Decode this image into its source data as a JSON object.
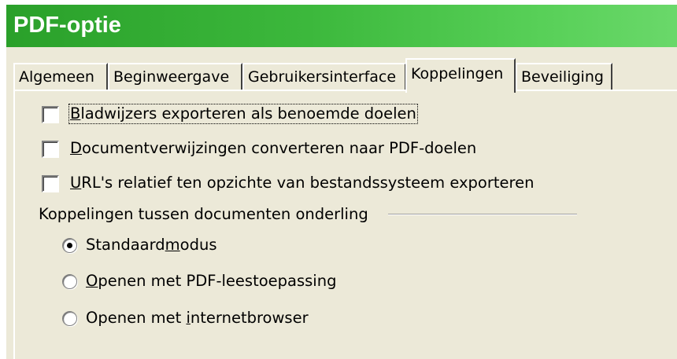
{
  "window": {
    "title": "PDF-optie"
  },
  "tabs": [
    {
      "label": "Algemeen",
      "active": false
    },
    {
      "label": "Beginweergave",
      "active": false
    },
    {
      "label": "Gebruikersinterface",
      "active": false
    },
    {
      "label": "Koppelingen",
      "active": true
    },
    {
      "label": "Beveiliging",
      "active": false
    }
  ],
  "checkboxes": [
    {
      "label_mnemonic": "B",
      "label_rest": "ladwijzers exporteren als benoemde doelen",
      "checked": false
    },
    {
      "label_mnemonic": "D",
      "label_rest": "ocumentverwijzingen converteren naar PDF-doelen",
      "checked": false
    },
    {
      "label_mnemonic": "U",
      "label_rest": "RL's relatief ten opzichte van bestandssysteem exporteren",
      "checked": false
    }
  ],
  "group": {
    "label": "Koppelingen tussen documenten onderling"
  },
  "radios": [
    {
      "label_before": "Standaard",
      "label_mnemonic": "m",
      "label_after": "odus",
      "selected": true
    },
    {
      "label_before": "",
      "label_mnemonic": "O",
      "label_after": "penen met PDF-leestoepassing",
      "selected": false
    },
    {
      "label_before": "Openen met ",
      "label_mnemonic": "i",
      "label_after": "nternetbrowser",
      "selected": false
    }
  ],
  "colors": {
    "titlebar_start": "#2aa02a",
    "titlebar_end": "#6ad86a",
    "dialog_face": "#ece9d8"
  }
}
